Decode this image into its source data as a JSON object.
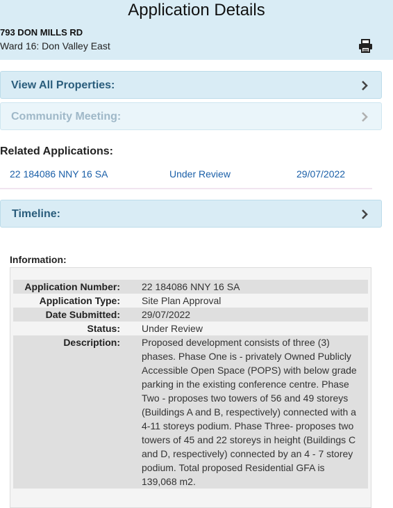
{
  "header": {
    "title": "Application Details",
    "address": "793 DON MILLS RD",
    "ward": "Ward 16: Don Valley East",
    "print_icon": "printer-icon"
  },
  "accordions": {
    "view_all_properties": "View All Properties:",
    "community_meeting": "Community Meeting:",
    "timeline": "Timeline:"
  },
  "related": {
    "title": "Related Applications:",
    "rows": [
      {
        "number": "22 184086 NNY 16 SA",
        "status": "Under Review",
        "date": "29/07/2022"
      }
    ]
  },
  "information": {
    "title": "Information:",
    "rows": [
      {
        "label": "Application Number:",
        "value": "22 184086 NNY 16 SA"
      },
      {
        "label": "Application Type:",
        "value": "Site Plan Approval"
      },
      {
        "label": "Date Submitted:",
        "value": "29/07/2022"
      },
      {
        "label": "Status:",
        "value": "Under Review"
      },
      {
        "label": "Description:",
        "value": "Proposed development consists of three (3) phases. Phase One is - privately Owned Publicly Accessible Open Space (POPS) with below grade parking in the existing conference centre. Phase Two - proposes two towers of 56 and 49 storeys (Buildings A and B, respectively) connected with a 4-11 storeys podium. Phase Three- proposes two towers of 45 and 22 storeys in height (Buildings C and D, respectively) connected by an 4 - 7 storey podium. Total proposed Residential GFA is 139,068 m2."
      }
    ]
  },
  "colors": {
    "header_bg": "#d9ecf5",
    "accordion_text": "#2a5d7c",
    "link": "#1a5fa8"
  }
}
